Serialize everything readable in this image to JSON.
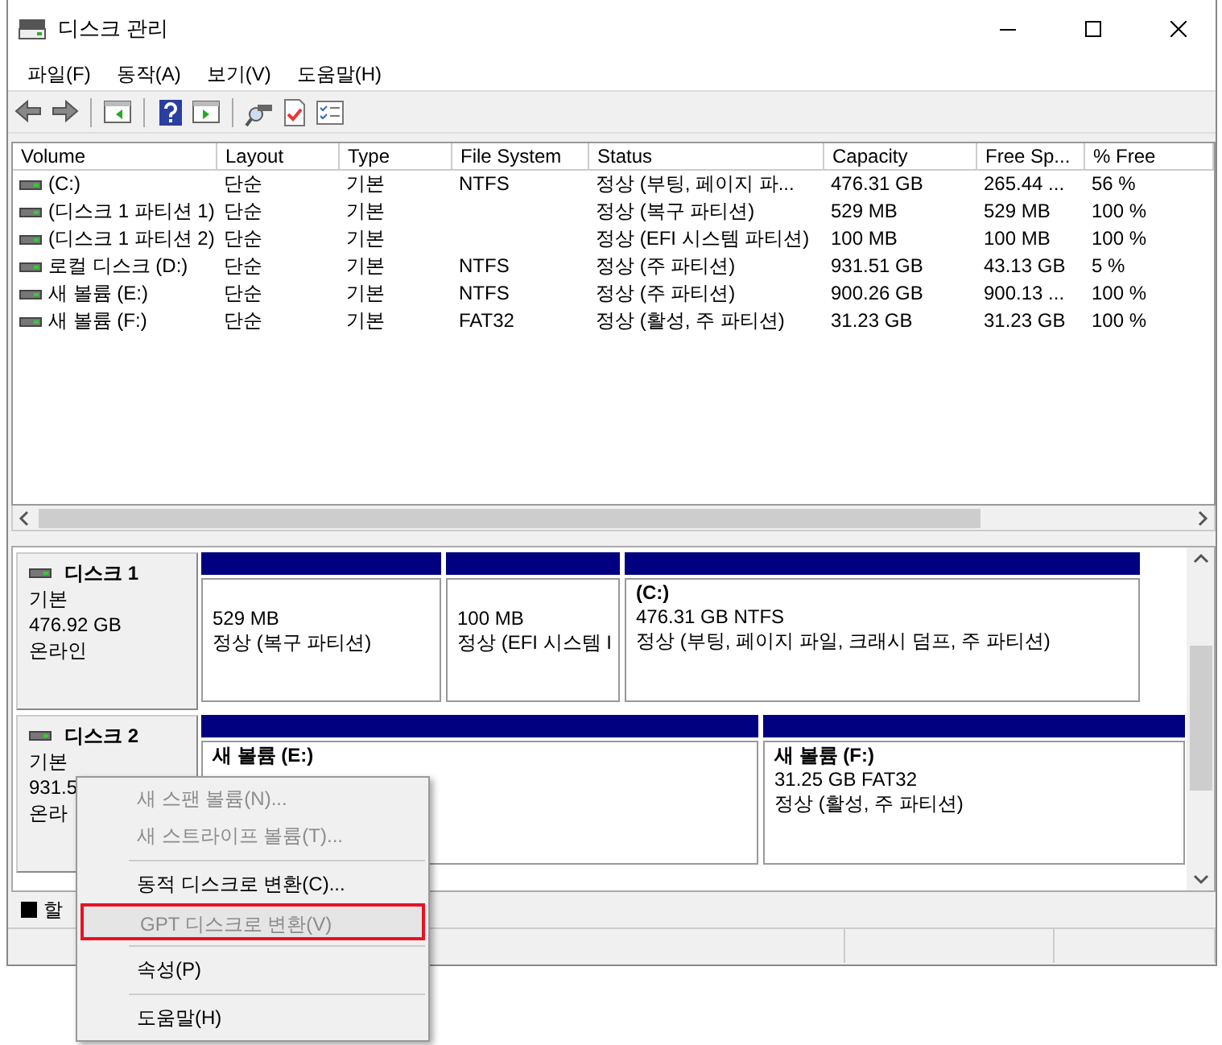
{
  "window": {
    "title": "디스크 관리"
  },
  "menu": [
    "파일(F)",
    "동작(A)",
    "보기(V)",
    "도움말(H)"
  ],
  "volume_table": {
    "columns": [
      "Volume",
      "Layout",
      "Type",
      "File System",
      "Status",
      "Capacity",
      "Free Sp...",
      "% Free"
    ],
    "rows": [
      [
        "(C:)",
        "단순",
        "기본",
        "NTFS",
        "정상 (부팅, 페이지 파...",
        "476.31 GB",
        "265.44 ...",
        "56 %"
      ],
      [
        "(디스크 1 파티션 1)",
        "단순",
        "기본",
        "",
        "정상 (복구 파티션)",
        "529 MB",
        "529 MB",
        "100 %"
      ],
      [
        "(디스크 1 파티션 2)",
        "단순",
        "기본",
        "",
        "정상 (EFI 시스템 파티션)",
        "100 MB",
        "100 MB",
        "100 %"
      ],
      [
        "로컬 디스크 (D:)",
        "단순",
        "기본",
        "NTFS",
        "정상 (주 파티션)",
        "931.51 GB",
        "43.13 GB",
        "5 %"
      ],
      [
        "새 볼륨 (E:)",
        "단순",
        "기본",
        "NTFS",
        "정상 (주 파티션)",
        "900.26 GB",
        "900.13 ...",
        "100 %"
      ],
      [
        "새 볼륨 (F:)",
        "단순",
        "기본",
        "FAT32",
        "정상 (활성, 주 파티션)",
        "31.23 GB",
        "31.23 GB",
        "100 %"
      ]
    ]
  },
  "disks": [
    {
      "name": "디스크 1",
      "type": "기본",
      "size": "476.92 GB",
      "state": "온라인",
      "partitions": [
        {
          "size": "529 MB",
          "status": "정상 (복구 파티션)"
        },
        {
          "size": "100 MB",
          "status": "정상 (EFI 시스템 I"
        },
        {
          "title": "(C:)",
          "size": "476.31 GB NTFS",
          "status": "정상 (부팅, 페이지 파일, 크래시 덤프, 주 파티션)"
        }
      ]
    },
    {
      "name": "디스크 2",
      "type": "기본",
      "size": "931.5",
      "state": "온라",
      "partitions": [
        {
          "title": "새 볼륨  (E:)"
        },
        {
          "title": "새 볼륨  (F:)",
          "size": "31.25 GB FAT32",
          "status": "정상 (활성, 주 파티션)"
        }
      ]
    }
  ],
  "legend": [
    "할"
  ],
  "context_menu": [
    {
      "kind": "item",
      "label": "새 스팬 볼륨(N)...",
      "disabled": true,
      "highlighted": false
    },
    {
      "kind": "item",
      "label": "새 스트라이프 볼륨(T)...",
      "disabled": true,
      "highlighted": false
    },
    {
      "kind": "separator"
    },
    {
      "kind": "item",
      "label": "동적 디스크로 변환(C)...",
      "disabled": false,
      "highlighted": false
    },
    {
      "kind": "item",
      "label": "GPT 디스크로 변환(V)",
      "disabled": true,
      "highlighted": true
    },
    {
      "kind": "separator"
    },
    {
      "kind": "item",
      "label": "속성(P)",
      "disabled": false,
      "highlighted": false
    },
    {
      "kind": "separator"
    },
    {
      "kind": "item",
      "label": "도움말(H)",
      "disabled": false,
      "highlighted": false
    }
  ]
}
